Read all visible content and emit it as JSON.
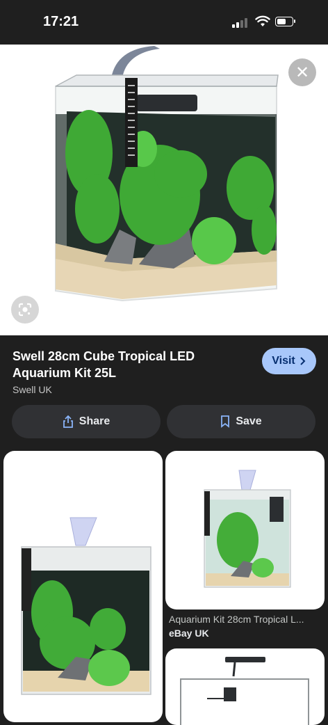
{
  "status": {
    "time": "17:21"
  },
  "result": {
    "title": "Swell 28cm Cube Tropical LED Aquarium Kit 25L",
    "source": "Swell UK",
    "visit_label": "Visit"
  },
  "actions": {
    "share_label": "Share",
    "save_label": "Save"
  },
  "related": [
    {
      "title": "",
      "source": ""
    },
    {
      "title": "Aquarium Kit 28cm Tropical L...",
      "source": "eBay UK"
    },
    {
      "title": "",
      "source": ""
    }
  ],
  "icons": {
    "close": "close-icon",
    "lens": "google-lens-icon",
    "share": "share-icon",
    "save": "bookmark-icon",
    "visit_arrow": "chevron-right-icon"
  },
  "colors": {
    "accent": "#a8c7fa",
    "background": "#1f1f1f",
    "button": "#303134"
  }
}
